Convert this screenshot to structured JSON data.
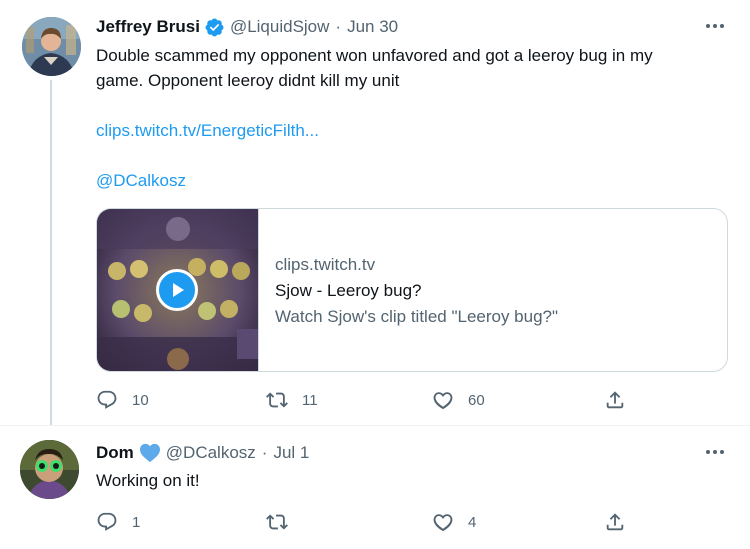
{
  "tweets": [
    {
      "author": "Jeffrey Brusi",
      "handle": "@LiquidSjow",
      "separator": "·",
      "date": "Jun 30",
      "text_lines": [
        "Double scammed my opponent won unfavored and got a leeroy bug in my",
        "game. Opponent leeroy didnt kill my unit"
      ],
      "links": [
        "clips.twitch.tv/EnergeticFilth...",
        "@DCalkosz"
      ],
      "card": {
        "domain": "clips.twitch.tv",
        "title": "Sjow - Leeroy bug?",
        "description": "Watch Sjow's clip titled \"Leeroy bug?\""
      },
      "actions": {
        "replies": "10",
        "retweets": "11",
        "likes": "60"
      },
      "icons": [
        "verified-badge-icon",
        "reply-icon",
        "retweet-icon",
        "like-icon",
        "share-icon",
        "more-icon",
        "play-icon"
      ]
    },
    {
      "author": "Dom",
      "handle": "@DCalkosz",
      "separator": "·",
      "date": "Jul 1",
      "text": "Working on it!",
      "actions": {
        "replies": "1",
        "retweets": "",
        "likes": "4"
      },
      "icons": [
        "blue-heart-icon",
        "reply-icon",
        "retweet-icon",
        "like-icon",
        "share-icon",
        "more-icon"
      ]
    }
  ],
  "colors": {
    "accent": "#1d9bf0",
    "secondary_text": "#536471",
    "primary_text": "#0f1419",
    "border": "#cfd9de",
    "heart_badge": "#5da9e9"
  }
}
